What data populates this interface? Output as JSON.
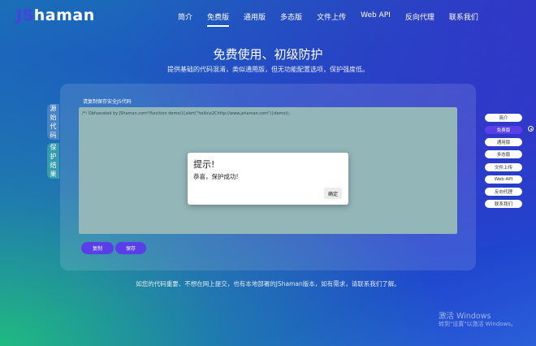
{
  "brand": {
    "prefix": "JS",
    "name": "haman",
    "accent": "#5a3fe8"
  },
  "nav": [
    {
      "label": "简介",
      "active": false
    },
    {
      "label": "免费版",
      "active": true
    },
    {
      "label": "通用版",
      "active": false
    },
    {
      "label": "多态版",
      "active": false
    },
    {
      "label": "文件上传",
      "active": false
    },
    {
      "label": "Web API",
      "active": false
    },
    {
      "label": "反向代理",
      "active": false
    },
    {
      "label": "联系我们",
      "active": false
    }
  ],
  "hero": {
    "title": "免费使用、初级防护",
    "subtitle": "提供基础的代码混淆，类似通用版，但无功能配置选项，保护强度低。"
  },
  "editor": {
    "label": "请复制保存安全JS代码",
    "code": "/*! Obfuscated by JShaman.com*/function demo(){alert(\"hello\\x2Chttp://www.jshaman.com\")}demo();",
    "tab_source": "源始代码",
    "tab_result": "保护结果",
    "copy_label": "复制",
    "save_label": "保存"
  },
  "footer_note": "如您的代码重要、不想在网上提交，也有本地部署的JShaman版本，如有需求，请联系我们了解。",
  "dialog": {
    "title": "提示!",
    "message": "恭喜，保护成功!",
    "ok_label": "确定"
  },
  "right_nav": [
    {
      "label": "简介",
      "active": false
    },
    {
      "label": "免费版",
      "active": true
    },
    {
      "label": "通用版",
      "active": false
    },
    {
      "label": "多态版",
      "active": false
    },
    {
      "label": "文件上传",
      "active": false
    },
    {
      "label": "Web API",
      "active": false
    },
    {
      "label": "反向代理",
      "active": false
    },
    {
      "label": "联系我们",
      "active": false
    }
  ],
  "watermark": {
    "line1": "激活 Windows",
    "line2": "转到\"设置\"以激活 Windows。"
  }
}
